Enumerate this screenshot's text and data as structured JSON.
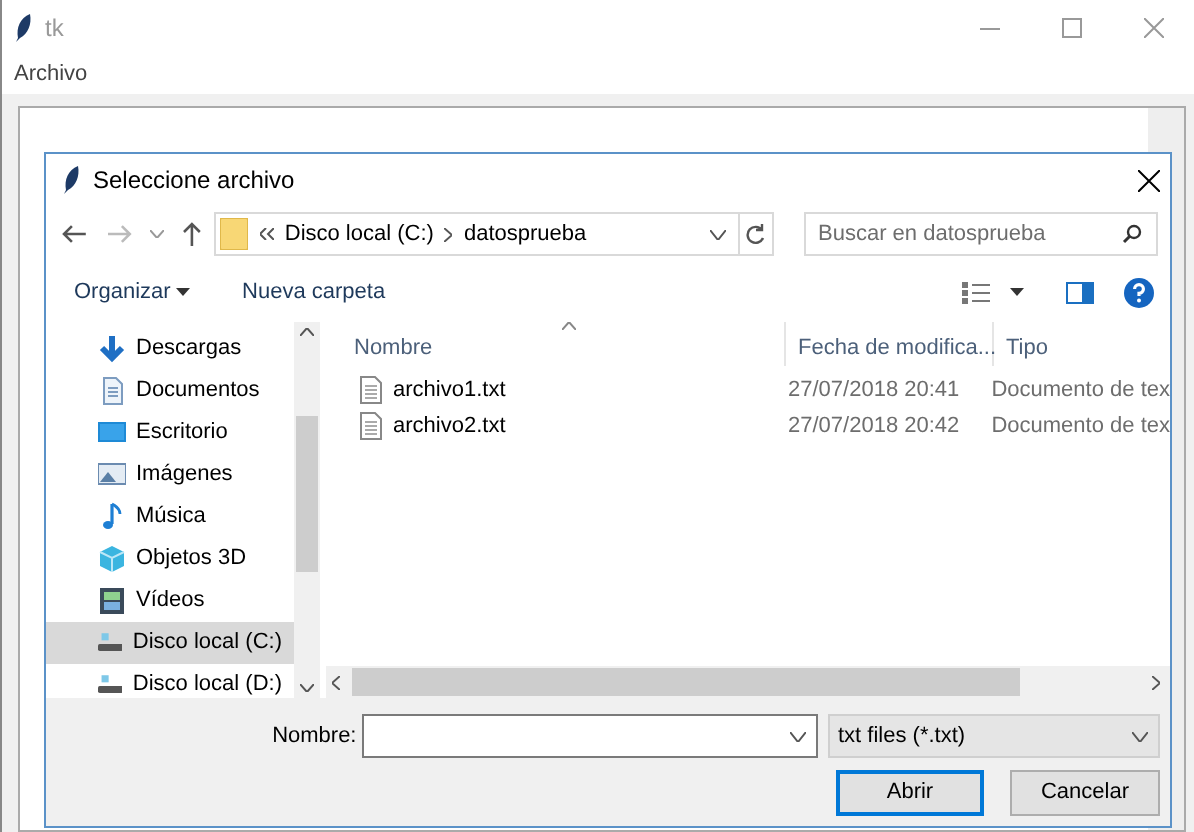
{
  "app_window": {
    "title": "tk",
    "menu": [
      "Archivo"
    ]
  },
  "dialog": {
    "title": "Seleccione archivo",
    "breadcrumb": [
      "Disco local (C:)",
      "datosprueba"
    ],
    "search": {
      "placeholder": "Buscar en datosprueba"
    },
    "toolbar": [
      {
        "label": "Organizar",
        "kind": "menu"
      },
      {
        "label": "Nueva carpeta",
        "kind": "plain"
      }
    ],
    "sidebar": [
      {
        "label": "Descargas",
        "kind": "downloads",
        "selected": false
      },
      {
        "label": "Documentos",
        "kind": "documents",
        "selected": false
      },
      {
        "label": "Escritorio",
        "kind": "desktop",
        "selected": false
      },
      {
        "label": "Imágenes",
        "kind": "pictures",
        "selected": false
      },
      {
        "label": "Música",
        "kind": "music",
        "selected": false
      },
      {
        "label": "Objetos 3D",
        "kind": "objects",
        "selected": false
      },
      {
        "label": "Vídeos",
        "kind": "videos",
        "selected": false
      },
      {
        "label": "Disco local (C:)",
        "kind": "drive",
        "selected": true
      },
      {
        "label": "Disco local (D:)",
        "kind": "drive",
        "selected": false
      }
    ],
    "columns": [
      {
        "label": "Nombre",
        "sorted": true
      },
      {
        "label": "Fecha de modifica...",
        "sorted": false
      },
      {
        "label": "Tipo",
        "sorted": false
      }
    ],
    "files": [
      {
        "name": "archivo1.txt",
        "date": "27/07/2018 20:41",
        "type": "Documento de tex"
      },
      {
        "name": "archivo2.txt",
        "date": "27/07/2018 20:42",
        "type": "Documento de tex"
      }
    ],
    "filename": {
      "label": "Nombre:"
    },
    "filetype": "txt files (*.txt)",
    "buttons": [
      {
        "label": "Abrir",
        "default": true
      },
      {
        "label": "Cancelar",
        "default": false
      }
    ]
  }
}
